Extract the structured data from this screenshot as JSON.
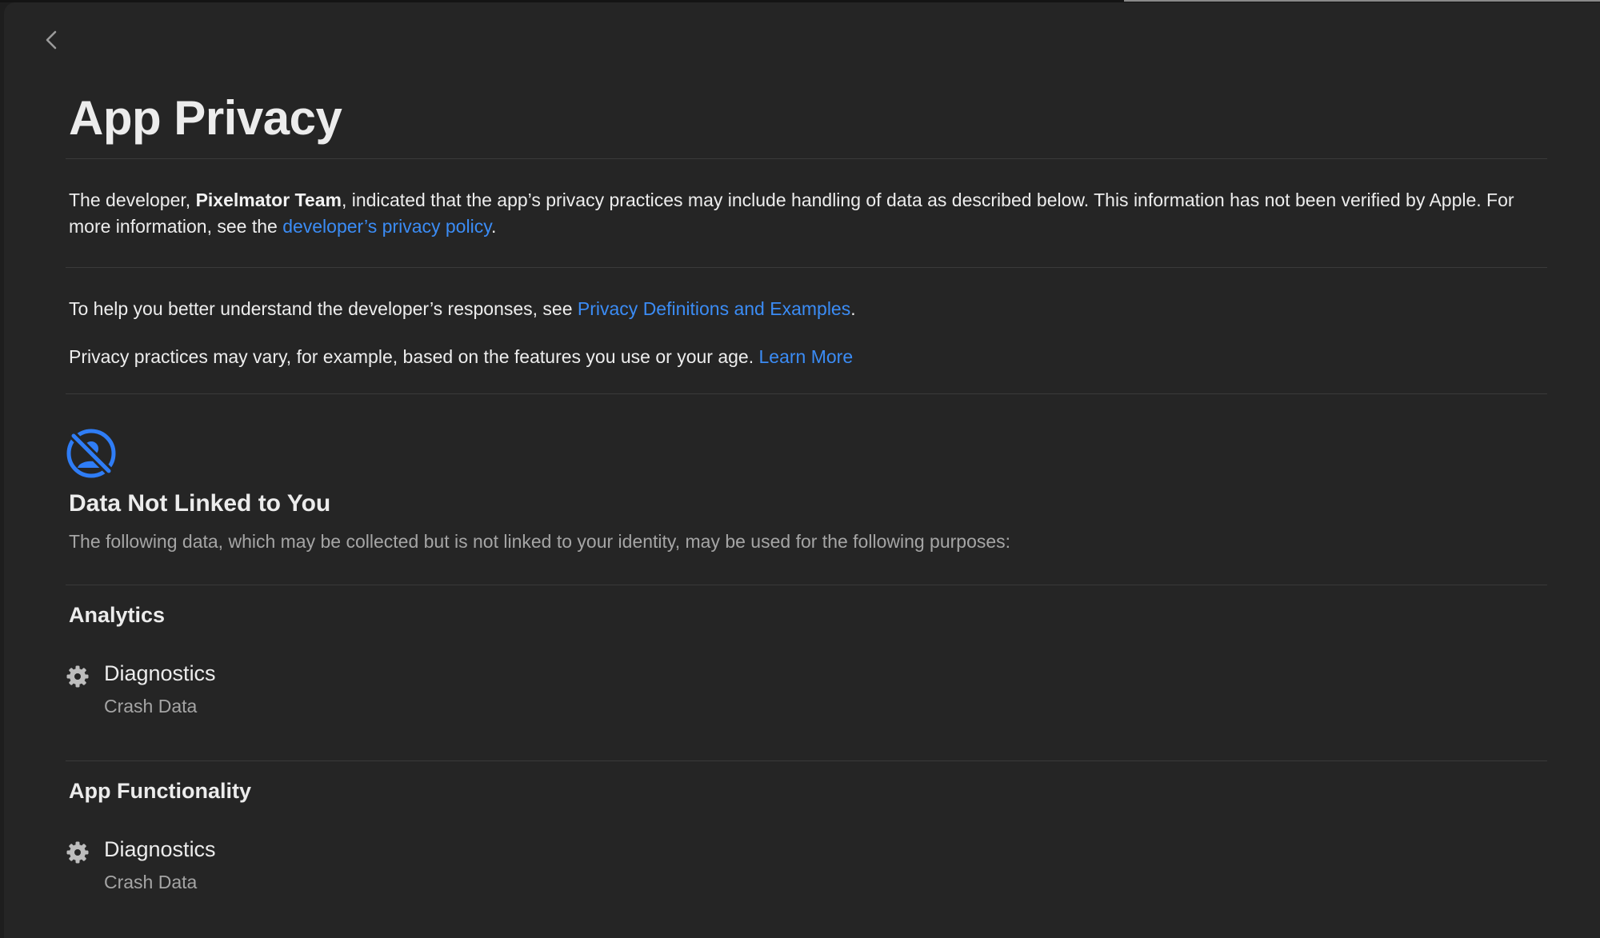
{
  "page": {
    "title": "App Privacy"
  },
  "intro": {
    "prefix": "The developer, ",
    "developer_name": "Pixelmator Team",
    "middle": ", indicated that the app’s privacy practices may include handling of data as described below. This information has not been verified by Apple. For more information, see the ",
    "policy_link": "developer’s privacy policy",
    "suffix": "."
  },
  "help": {
    "prefix": "To help you better understand the developer’s responses, see ",
    "link": "Privacy Definitions and Examples",
    "suffix": "."
  },
  "vary": {
    "text": "Privacy practices may vary, for example, based on the features you use or your age. ",
    "link": "Learn More"
  },
  "section": {
    "icon": "data-not-linked-icon",
    "title": "Data Not Linked to You",
    "description": "The following data, which may be collected but is not linked to your identity, may be used for the following purposes:"
  },
  "purposes": [
    {
      "title": "Analytics",
      "items": [
        {
          "icon": "gear-icon",
          "type": "Diagnostics",
          "detail": "Crash Data"
        }
      ]
    },
    {
      "title": "App Functionality",
      "items": [
        {
          "icon": "gear-icon",
          "type": "Diagnostics",
          "detail": "Crash Data"
        }
      ]
    }
  ],
  "colors": {
    "background": "#252525",
    "link": "#3b8cf5",
    "accent_icon": "#2f7df6",
    "secondary_text": "#a5a5a5"
  }
}
